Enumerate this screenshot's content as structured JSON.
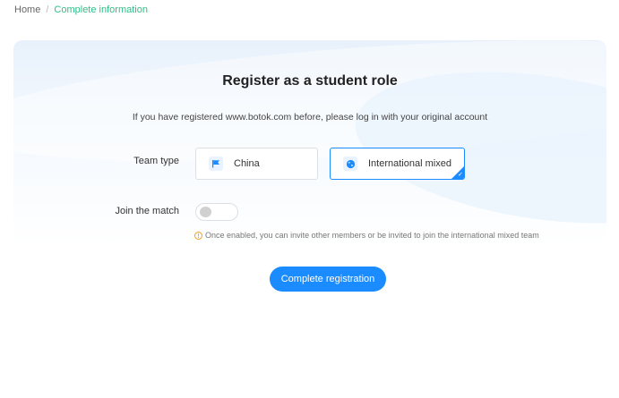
{
  "breadcrumb": {
    "home": "Home",
    "separator": "/",
    "current": "Complete information"
  },
  "page": {
    "title": "Register as a student role",
    "notice": "If you have registered www.botok.com before, please log in with your original account"
  },
  "form": {
    "team_type_label": "Team type",
    "team_type_options": [
      {
        "label": "China",
        "icon": "flag-icon",
        "selected": false
      },
      {
        "label": "International mixed",
        "icon": "globe-icon",
        "selected": true
      }
    ],
    "join_match_label": "Join the match",
    "join_match_enabled": false,
    "hint": "Once enabled, you can invite other members or be invited to join the international mixed team",
    "submit_label": "Complete registration"
  },
  "colors": {
    "accent": "#1a8cff",
    "breadcrumb_active": "#2dbf86",
    "hint_icon": "#f0a020"
  }
}
